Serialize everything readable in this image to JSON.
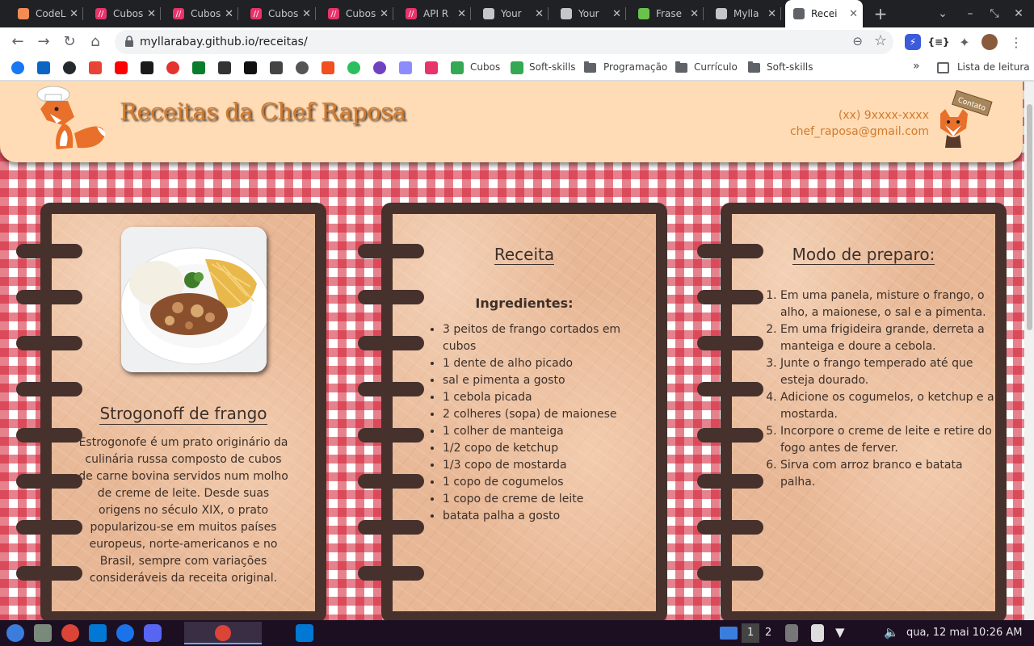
{
  "browser": {
    "tabs": [
      {
        "title": "CodeL",
        "color": "#f28b54",
        "glyph": ""
      },
      {
        "title": "Cubos",
        "color": "#e8336b",
        "glyph": "//"
      },
      {
        "title": "Cubos",
        "color": "#e8336b",
        "glyph": "//"
      },
      {
        "title": "Cubos",
        "color": "#e8336b",
        "glyph": "//"
      },
      {
        "title": "Cubos",
        "color": "#e8336b",
        "glyph": "//"
      },
      {
        "title": "API R",
        "color": "#e8336b",
        "glyph": "//"
      },
      {
        "title": "Your",
        "color": "#c3c6cb",
        "glyph": "github-icon"
      },
      {
        "title": "Your",
        "color": "#c3c6cb",
        "glyph": "github-icon"
      },
      {
        "title": "Frase",
        "color": "#6ac24a",
        "glyph": "plant-icon"
      },
      {
        "title": "Mylla",
        "color": "#c3c6cb",
        "glyph": "github-icon"
      },
      {
        "title": "Recei",
        "color": "#5f6368",
        "glyph": "globe-icon",
        "active": true
      }
    ],
    "url": "myllarabay.github.io/receitas/",
    "bookmarks": [
      {
        "label": "Cubos",
        "color": "#34a853"
      },
      {
        "label": "Soft-skills",
        "color": "#34a853"
      },
      {
        "label": "Programação",
        "folder": true
      },
      {
        "label": "Currículo",
        "folder": true
      },
      {
        "label": "Soft-skills",
        "folder": true
      }
    ],
    "reading_list": "Lista de leitura"
  },
  "header": {
    "title": "Receitas da Chef Raposa",
    "phone": "(xx) 9xxxx-xxxx",
    "email": "chef_raposa@gmail.com",
    "contact_badge": "Contato"
  },
  "recipe": {
    "name": "Strogonoff de frango",
    "description": "Estrogonofe é um prato originário da culinária russa composto de cubos de carne bovina servidos num molho de creme de leite. Desde suas origens no século XIX, o prato popularizou-se em muitos países europeus, norte-americanos e no Brasil, sempre com variações consideráveis da receita original."
  },
  "ingredients_card": {
    "title": "Receita",
    "subtitle": "Ingredientes:",
    "items": [
      "3 peitos de frango cortados em cubos",
      "1 dente de alho picado",
      "sal e pimenta a gosto",
      "1 cebola picada",
      "2 colheres (sopa) de maionese",
      "1 colher de manteiga",
      "1/2 copo de ketchup",
      "1/3 copo de mostarda",
      "1 copo de cogumelos",
      "1 copo de creme de leite",
      "batata palha a gosto"
    ]
  },
  "steps_card": {
    "title": "Modo de preparo:",
    "steps": [
      "Em uma panela, misture o frango, o alho, a maionese, o sal e a pimenta.",
      "Em uma frigideira grande, derreta a manteiga e doure a cebola.",
      "Junte o frango temperado até que esteja dourado.",
      "Adicione os cogumelos, o ketchup e a mostarda.",
      "Incorpore o creme de leite e retire do fogo antes de ferver.",
      "Sirva com arroz branco e batata palha."
    ]
  },
  "taskbar": {
    "workspaces": [
      "1",
      "2"
    ],
    "clock": "qua, 12 mai 10:26 AM"
  }
}
